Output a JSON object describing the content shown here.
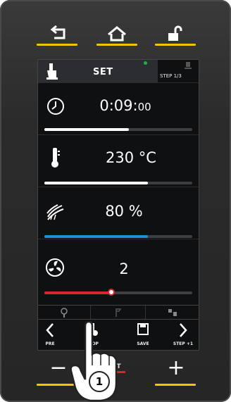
{
  "colors": {
    "accent": "#f5c400",
    "time_bar": "#ffffff",
    "temp_bar": "#ffffff",
    "humidity_bar": "#1e8fd6",
    "fan_bar": "#d7262c",
    "status_dot": "#19b34a"
  },
  "top_buttons": [
    {
      "icon": "back-arrow-icon"
    },
    {
      "icon": "home-icon"
    },
    {
      "icon": "unlock-icon"
    }
  ],
  "screen": {
    "header": {
      "title": "SET",
      "step": "STEP 1/3"
    },
    "rows": [
      {
        "icon": "clock-icon",
        "value": "0:09:",
        "value_small": "00",
        "level": 0.57
      },
      {
        "icon": "thermometer-icon",
        "value": "230 °C",
        "level": 0.7
      },
      {
        "icon": "humidity-icon",
        "value": "80 %",
        "level": 0.7
      },
      {
        "icon": "fan-icon",
        "value": "2",
        "level": 0.45
      }
    ],
    "bottom_buttons": [
      {
        "label": "PRE",
        "icon": "chevron-left-icon"
      },
      {
        "label": "STOP",
        "icon": "stop-icon"
      },
      {
        "label": "SAVE",
        "icon": "save-icon"
      },
      {
        "label": "STEP +1",
        "icon": "chevron-right-icon"
      }
    ]
  },
  "hardware": {
    "minus": "−",
    "plus": "+",
    "start_line1": "ART",
    "start_line2": "OP"
  },
  "callout": "1"
}
